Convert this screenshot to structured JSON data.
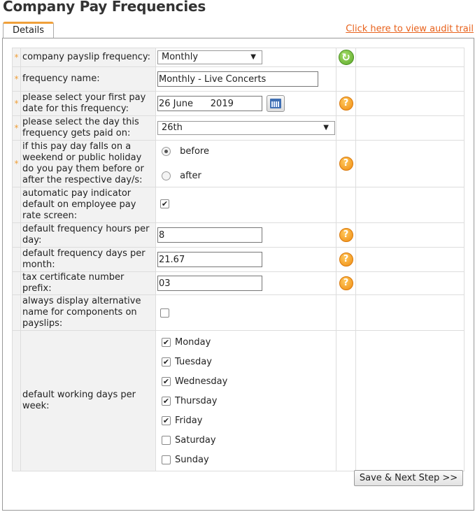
{
  "page": {
    "title": "Company Pay Frequencies",
    "tab_details": "Details",
    "audit_link": "Click here to view audit trail"
  },
  "form": {
    "required_marker": "*",
    "payslip_frequency": {
      "label": "company payslip frequency:",
      "value": "Monthly",
      "arrow": "▼"
    },
    "frequency_name": {
      "label": "frequency name:",
      "value": "Monthly - Live Concerts"
    },
    "first_pay_date": {
      "label": "please select your first pay date for this frequency:",
      "value": "26 June      2019"
    },
    "pay_day": {
      "label": "please select the day this frequency gets paid on:",
      "value": "26th",
      "arrow": "▼"
    },
    "holiday_rule": {
      "label": "if this pay day falls on a weekend or public holiday do you pay them before or after the respective day/s:",
      "options": [
        "before",
        "after"
      ],
      "selected": "before"
    },
    "auto_pay_indicator": {
      "label": "automatic pay indicator default on employee pay rate screen:",
      "checked": true
    },
    "hours_per_day": {
      "label": "default frequency hours per day:",
      "value": "8"
    },
    "days_per_month": {
      "label": "default frequency days per month:",
      "value": "21.67"
    },
    "tax_prefix": {
      "label": "tax certificate number prefix:",
      "value": "03"
    },
    "alt_name": {
      "label": "always display alternative name for components on payslips:",
      "checked": false
    },
    "working_days": {
      "label": "default working days per week:",
      "days": [
        {
          "name": "Monday",
          "checked": true
        },
        {
          "name": "Tuesday",
          "checked": true
        },
        {
          "name": "Wednesday",
          "checked": true
        },
        {
          "name": "Thursday",
          "checked": true
        },
        {
          "name": "Friday",
          "checked": true
        },
        {
          "name": "Saturday",
          "checked": false
        },
        {
          "name": "Sunday",
          "checked": false
        }
      ]
    }
  },
  "icons": {
    "help_glyph": "?",
    "refresh_glyph": "↻",
    "check_glyph": "✔"
  },
  "actions": {
    "save_next": "Save & Next Step >>"
  },
  "colors": {
    "accent": "#e8621c",
    "tab_accent": "#f0a03a",
    "label_bg": "#f2f2f2"
  }
}
